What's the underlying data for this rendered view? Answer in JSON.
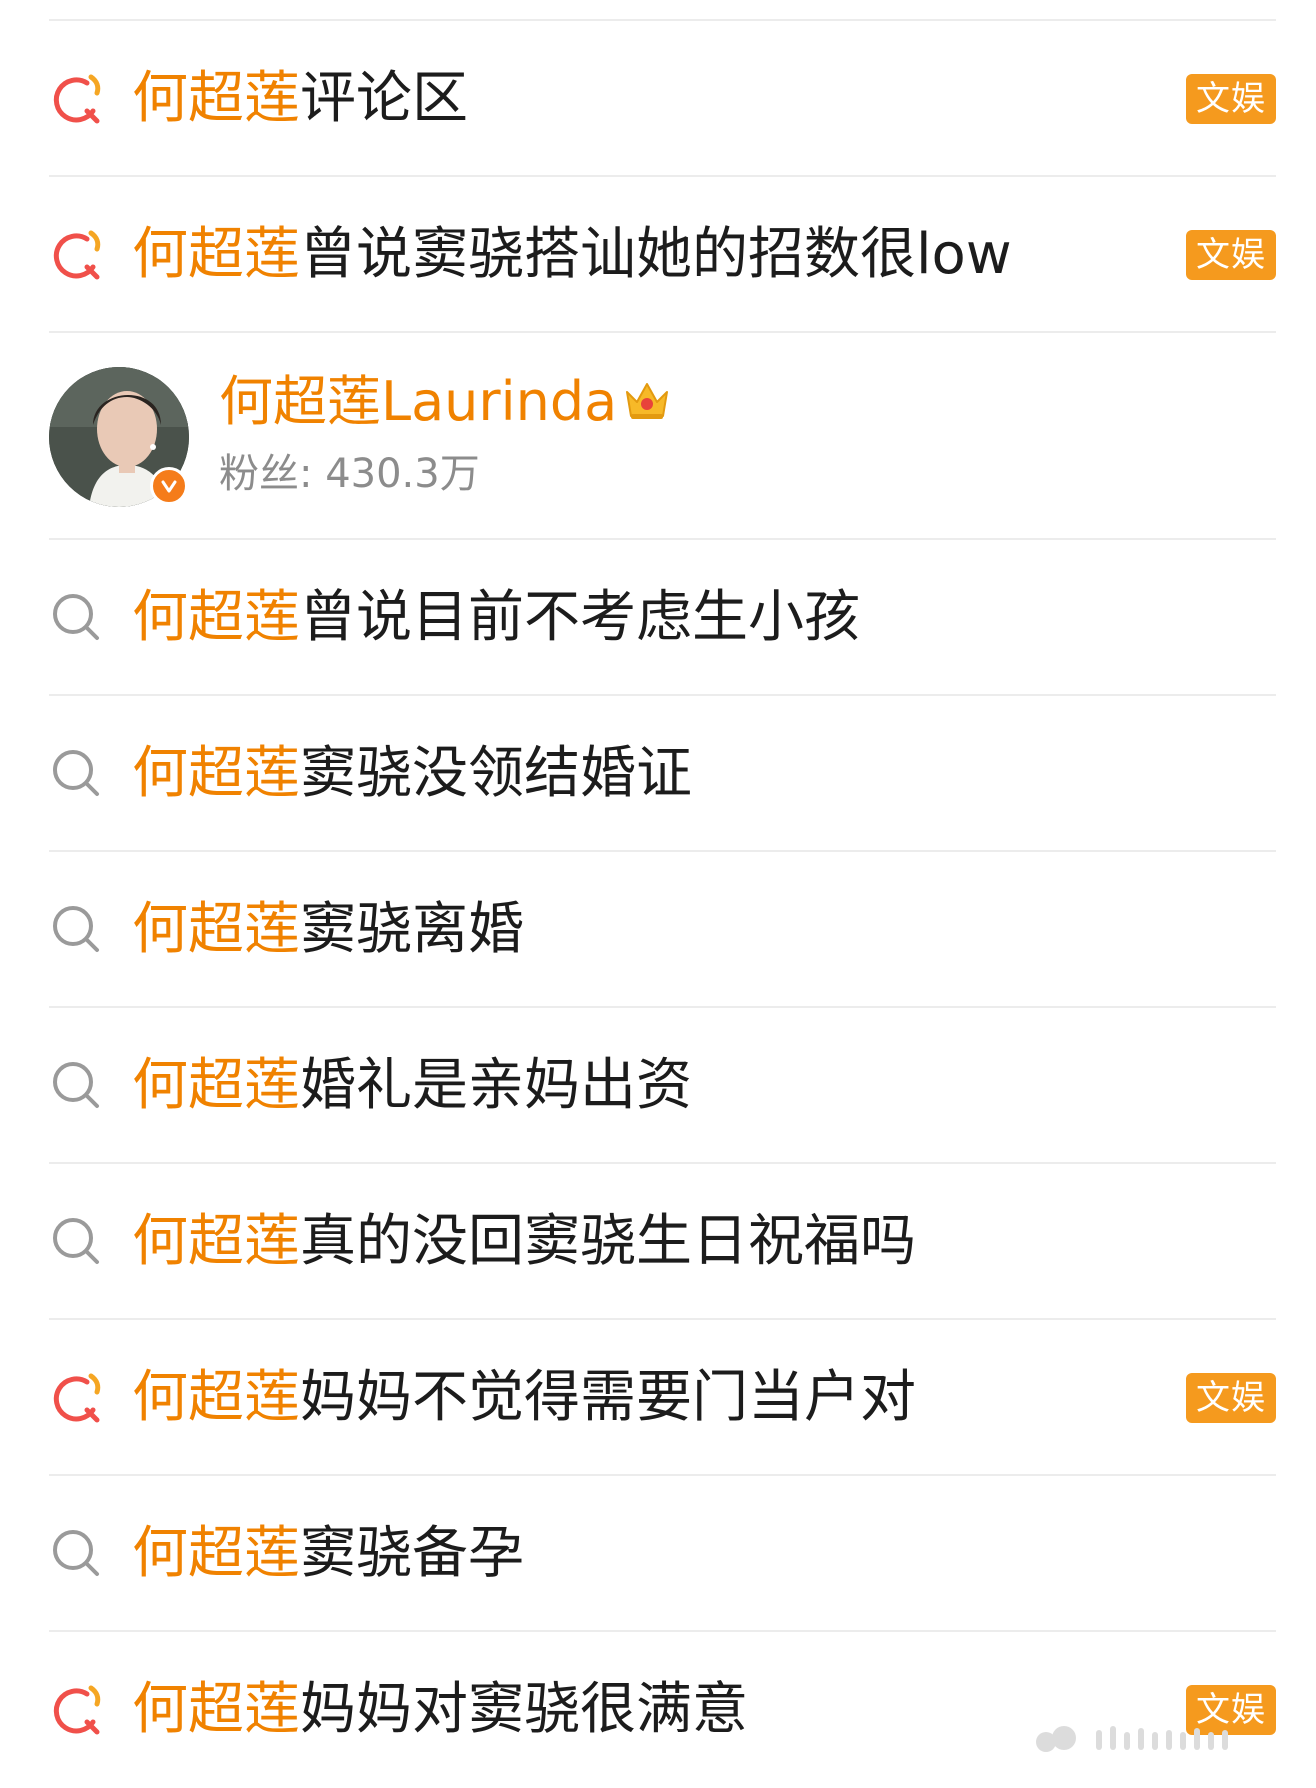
{
  "accent_color": "#f08200",
  "badge_color": "#f59a1e",
  "suggestions_top": [
    {
      "icon": "hot-search-icon",
      "highlight": "何超莲",
      "rest": "评论区",
      "badge": "文娱"
    },
    {
      "icon": "hot-search-icon",
      "highlight": "何超莲",
      "rest": "曾说窦骁搭讪她的招数很low",
      "badge": "文娱"
    }
  ],
  "user": {
    "name": "何超莲Laurinda",
    "fans_label": "粉丝:",
    "fans_value": "430.3万",
    "crown_icon": "crown-icon",
    "verified_icon": "verified-v-icon"
  },
  "suggestions_bottom": [
    {
      "icon": "search-icon",
      "highlight": "何超莲",
      "rest": "曾说目前不考虑生小孩",
      "badge": ""
    },
    {
      "icon": "search-icon",
      "highlight": "何超莲",
      "rest": "窦骁没领结婚证",
      "badge": ""
    },
    {
      "icon": "search-icon",
      "highlight": "何超莲",
      "rest": "窦骁离婚",
      "badge": ""
    },
    {
      "icon": "search-icon",
      "highlight": "何超莲",
      "rest": "婚礼是亲妈出资",
      "badge": ""
    },
    {
      "icon": "search-icon",
      "highlight": "何超莲",
      "rest": "真的没回窦骁生日祝福吗",
      "badge": ""
    },
    {
      "icon": "hot-search-icon",
      "highlight": "何超莲",
      "rest": "妈妈不觉得需要门当户对",
      "badge": "文娱"
    },
    {
      "icon": "search-icon",
      "highlight": "何超莲",
      "rest": "窦骁备孕",
      "badge": ""
    },
    {
      "icon": "hot-search-icon",
      "highlight": "何超莲",
      "rest": "妈妈对窦骁很满意",
      "badge": "文娱"
    }
  ]
}
